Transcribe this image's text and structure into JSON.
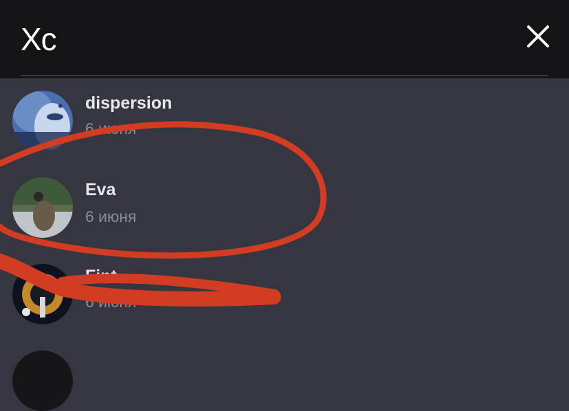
{
  "header": {
    "title": "Xc",
    "close_icon": "close-icon"
  },
  "list": [
    {
      "name": "dispersion",
      "date": "6 июня"
    },
    {
      "name": "Eva",
      "date": "6 июня"
    },
    {
      "name": "Fint",
      "date": "6 июня"
    }
  ],
  "colors": {
    "background": "#353640",
    "header": "#141418",
    "name_text": "#e6e7ec",
    "date_text": "#8a8c96",
    "annotation": "#d23c22"
  }
}
